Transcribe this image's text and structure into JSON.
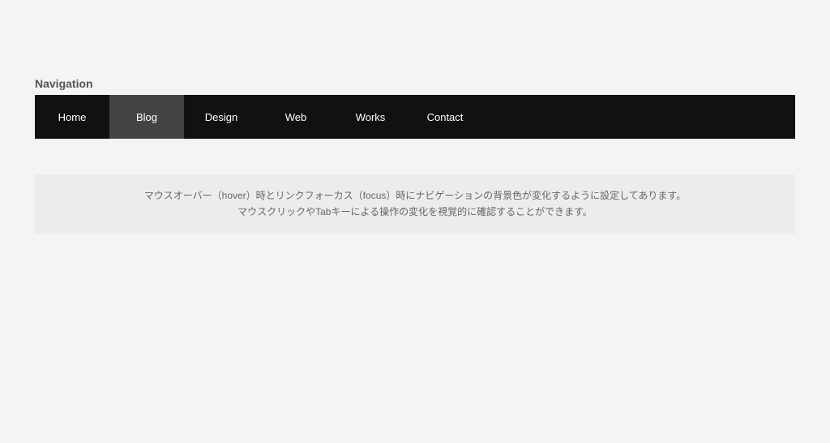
{
  "nav": {
    "title": "Navigation",
    "items": [
      {
        "label": "Home",
        "hovered": false
      },
      {
        "label": "Blog",
        "hovered": true
      },
      {
        "label": "Design",
        "hovered": false
      },
      {
        "label": "Web",
        "hovered": false
      },
      {
        "label": "Works",
        "hovered": false
      },
      {
        "label": "Contact",
        "hovered": false
      }
    ]
  },
  "description": {
    "line1": "マウスオーバー（hover）時とリンクフォーカス（focus）時にナビゲーションの背景色が変化するように設定してあります。",
    "line2": "マウスクリックやTabキーによる操作の変化を視覚的に確認することができます。"
  }
}
